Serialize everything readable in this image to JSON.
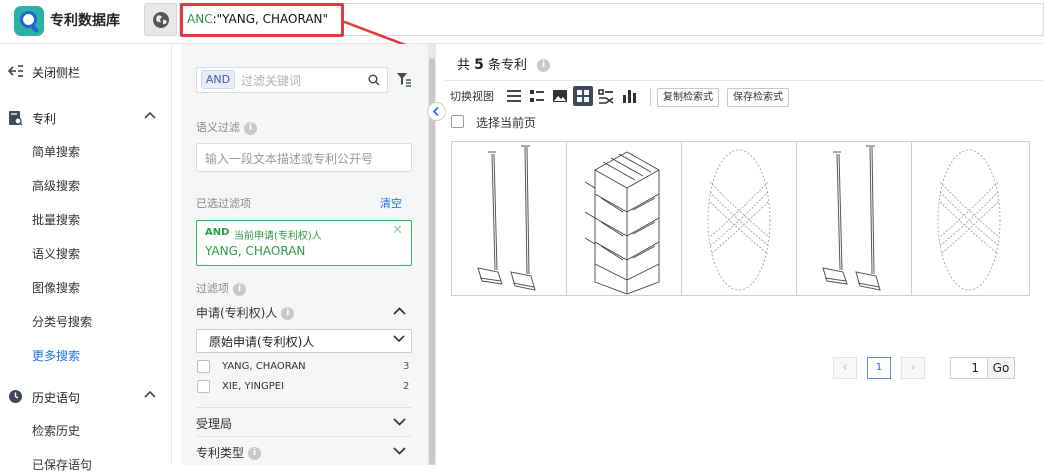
{
  "app": {
    "title": "专利数据库"
  },
  "query": {
    "field": "ANC",
    "value": ":\"YANG, CHAORAN\""
  },
  "nav": {
    "collapse_label": "关闭侧栏",
    "patent_group": "专利",
    "patent_items": [
      "简单搜索",
      "高级搜索",
      "批量搜索",
      "语义搜索",
      "图像搜索",
      "分类号搜索",
      "更多搜索"
    ],
    "history_group": "历史语句",
    "history_items": [
      "检索历史",
      "已保存语句"
    ]
  },
  "filter": {
    "op_pill": "AND",
    "search_placeholder": "过滤关键词",
    "semantic_label": "语义过滤",
    "semantic_placeholder": "输入一段文本描述或专利公开号",
    "selected_label": "已选过滤项",
    "clear_label": "清空",
    "chip": {
      "op": "AND",
      "field": "当前申请(专利权)人",
      "value": "YANG, CHAORAN"
    },
    "items_label": "过滤项",
    "applicant_group": "申请(专利权)人",
    "applicant_dropdown": "原始申请(专利权)人",
    "applicants": [
      {
        "name": "YANG, CHAORAN",
        "count": "3"
      },
      {
        "name": "XIE, YINGPEI",
        "count": "2"
      }
    ],
    "office_group": "受理局",
    "type_group": "专利类型"
  },
  "results": {
    "total_prefix": "共",
    "total_count": "5",
    "total_suffix": "条专利",
    "view_label": "切换视图",
    "copy_query": "复制检索式",
    "save_query": "保存检索式",
    "select_page": "选择当前页",
    "thumbnails": [
      "mop",
      "shelf",
      "slipper",
      "mop",
      "slipper"
    ]
  },
  "pagination": {
    "prev": "‹",
    "current": "1",
    "next": "›",
    "goto_value": "1",
    "go_label": "Go"
  },
  "colors": {
    "accent": "#1a73e8",
    "highlight_red": "#e03a3a",
    "green": "#2a9d4a"
  }
}
